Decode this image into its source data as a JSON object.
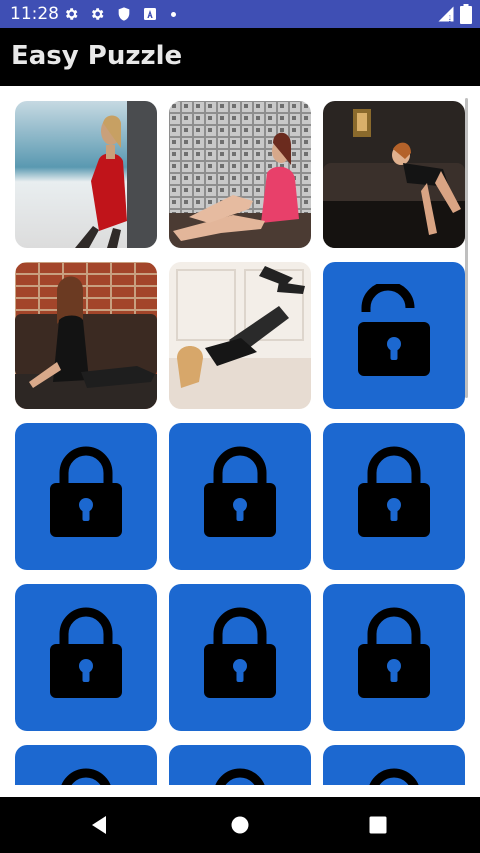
{
  "status_bar": {
    "time": "11:28",
    "icons": [
      "settings-icon",
      "settings-icon",
      "shield-icon",
      "app-notification-icon",
      "dot-icon",
      "signal-icon",
      "battery-icon"
    ]
  },
  "app_bar": {
    "title": "Easy Puzzle"
  },
  "colors": {
    "status_bar": "#3f4fb4",
    "app_bar": "#000000",
    "locked_tile": "#1c68d0",
    "lock_glyph": "#000000"
  },
  "puzzles": [
    {
      "state": "unlocked-photo",
      "description": "woman in red dress"
    },
    {
      "state": "unlocked-photo",
      "description": "woman in pink dress by mosaic wall"
    },
    {
      "state": "unlocked-photo",
      "description": "woman lying on leather sofa"
    },
    {
      "state": "unlocked-photo",
      "description": "woman on floor by brick wall"
    },
    {
      "state": "unlocked-photo",
      "description": "woman in black dress on floor"
    },
    {
      "state": "unlocked-next",
      "icon": "lock-open-icon"
    },
    {
      "state": "locked",
      "icon": "lock-icon"
    },
    {
      "state": "locked",
      "icon": "lock-icon"
    },
    {
      "state": "locked",
      "icon": "lock-icon"
    },
    {
      "state": "locked",
      "icon": "lock-icon"
    },
    {
      "state": "locked",
      "icon": "lock-icon"
    },
    {
      "state": "locked",
      "icon": "lock-icon"
    },
    {
      "state": "locked",
      "icon": "lock-icon"
    },
    {
      "state": "locked",
      "icon": "lock-icon"
    },
    {
      "state": "locked",
      "icon": "lock-icon"
    }
  ],
  "nav_bar": {
    "buttons": [
      "back-icon",
      "home-icon",
      "recents-icon"
    ]
  }
}
